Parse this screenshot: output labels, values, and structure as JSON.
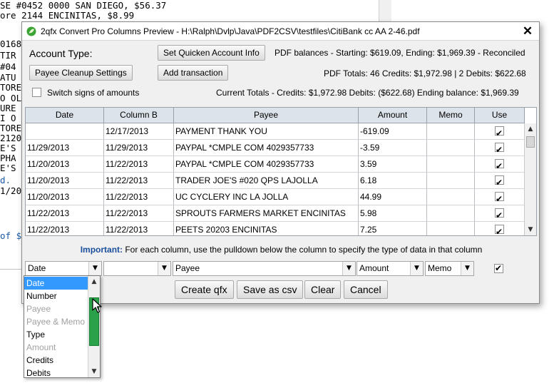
{
  "background": {
    "lines": [
      "SE #0452 0000 SAN DIEGO, $56.37",
      "ore 2144 ENCINITAS, $8.99",
      "0168",
      "TIR",
      "#04",
      "ATU",
      "TORE",
      "O OL",
      "URE",
      "I O",
      "TORE",
      "2120",
      "E'S",
      "PHA",
      "E'S",
      "d.",
      "1/20",
      "of $"
    ]
  },
  "window": {
    "title": "2qfx Convert Pro Columns Preview - H:\\Ralph\\Dvlp\\Java\\PDF2CSV\\testfiles\\CitiBank cc AA 2-46.pdf",
    "close_glyph": "✕"
  },
  "top": {
    "account_type_label": "Account Type:",
    "set_quicken_btn": "Set Quicken Account Info",
    "pdf_balances": "PDF balances - Starting: $619.09, Ending: $1,969.39  - Reconciled",
    "payee_cleanup_btn": "Payee Cleanup Settings",
    "add_transaction_btn": "Add transaction",
    "pdf_totals": "PDF Totals:  46 Credits: $1,972.98 | 2 Debits: $622.68",
    "switch_signs_label": "Switch signs of amounts",
    "current_totals": "Current Totals - Credits: $1,972.98  Debits: ($622.68)   Ending balance: $1,969.39"
  },
  "table": {
    "headers": [
      "Date",
      "Column B",
      "Payee",
      "Amount",
      "Memo",
      "Use"
    ],
    "rows": [
      {
        "date": "",
        "colb": "12/17/2013",
        "payee": "PAYMENT THANK YOU",
        "amount": "-619.09",
        "memo": "",
        "use": true
      },
      {
        "date": "11/29/2013",
        "colb": "11/29/2013",
        "payee": "PAYPAL *CMPLE COM  4029357733",
        "amount": "-3.59",
        "memo": "",
        "use": true
      },
      {
        "date": "11/20/2013",
        "colb": "11/22/2013",
        "payee": "PAYPAL *CMPLE COM  4029357733",
        "amount": "3.59",
        "memo": "",
        "use": true
      },
      {
        "date": "11/20/2013",
        "colb": "11/22/2013",
        "payee": "TRADER JOE'S #020 QPS LAJOLLA",
        "amount": "6.18",
        "memo": "",
        "use": true
      },
      {
        "date": "11/20/2013",
        "colb": "11/22/2013",
        "payee": "UC CYCLERY INC  LA JOLLA",
        "amount": "44.99",
        "memo": "",
        "use": true
      },
      {
        "date": "11/22/2013",
        "colb": "11/22/2013",
        "payee": "SPROUTS FARMERS MARKET ENCINITAS",
        "amount": "5.98",
        "memo": "",
        "use": true
      },
      {
        "date": "11/22/2013",
        "colb": "11/22/2013",
        "payee": "PEETS 20203  ENCINITAS",
        "amount": "7.25",
        "memo": "",
        "use": true
      }
    ]
  },
  "important": {
    "bold": "Important:",
    "text": " For each column, use the pulldown below the column to specify the type of data in that column"
  },
  "column_types": {
    "date": "Date",
    "colb": "",
    "payee": "Payee",
    "amount": "Amount",
    "memo": "Memo",
    "use_checked": true
  },
  "buttons": {
    "create_qfx": "Create qfx",
    "save_csv": "Save as csv",
    "clear": "Clear",
    "cancel": "Cancel"
  },
  "dropdown": {
    "options": [
      {
        "label": "Date",
        "state": "selected"
      },
      {
        "label": "Number",
        "state": "enabled"
      },
      {
        "label": "Payee",
        "state": "disabled"
      },
      {
        "label": "Payee & Memo",
        "state": "disabled"
      },
      {
        "label": "Type",
        "state": "enabled"
      },
      {
        "label": "Amount",
        "state": "disabled"
      },
      {
        "label": "Credits",
        "state": "enabled"
      },
      {
        "label": "Debits",
        "state": "enabled"
      }
    ]
  },
  "icons": {
    "app": "app-leaf-icon",
    "close": "close-icon",
    "dropdown_arrow": "chevron-down-icon",
    "scroll_up": "scroll-up-icon",
    "scroll_down": "scroll-down-icon",
    "cursor": "mouse-cursor-icon"
  },
  "colors": {
    "selection": "#3399ff",
    "important_label": "#1a4f9c",
    "scroll_thumb": "#2aa14a",
    "header_bg": "#dde3ea"
  }
}
